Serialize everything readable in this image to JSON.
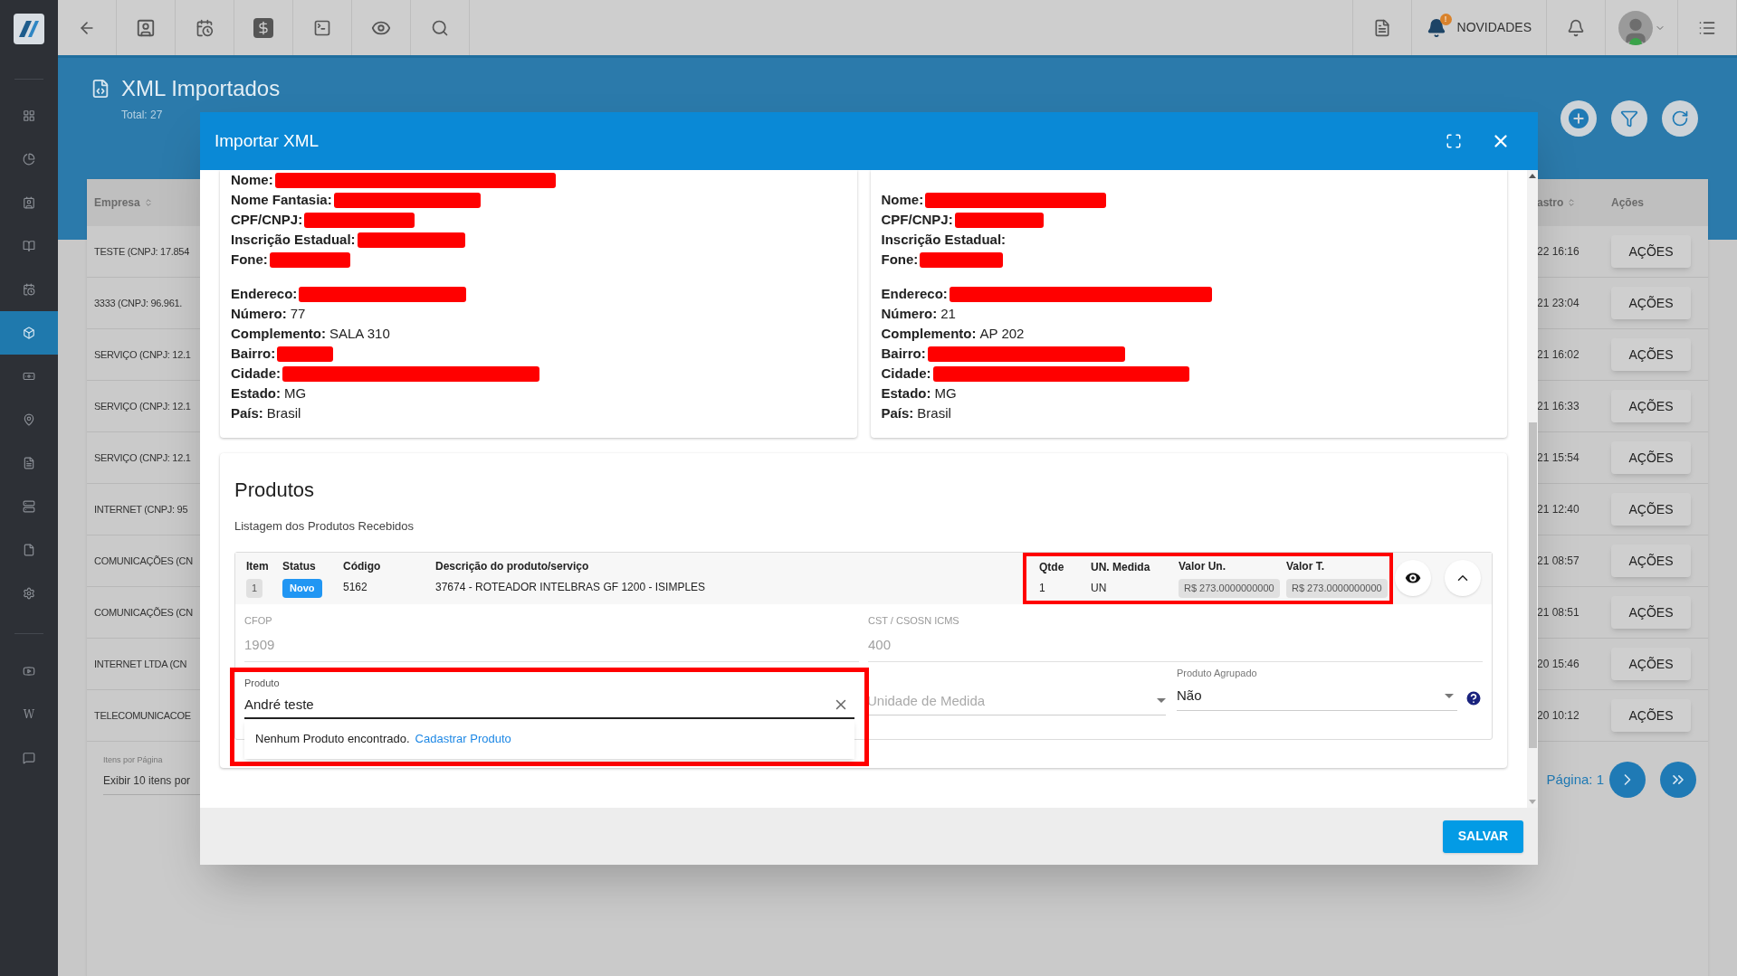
{
  "sidebar": {
    "items": [
      {
        "selected": false
      },
      {
        "selected": false
      },
      {
        "selected": false
      },
      {
        "selected": false
      },
      {
        "selected": false
      },
      {
        "selected": true
      },
      {
        "selected": false
      },
      {
        "selected": false
      },
      {
        "selected": false
      },
      {
        "selected": false
      },
      {
        "selected": false
      },
      {
        "selected": false
      },
      {
        "selected": false
      },
      {
        "selected": false,
        "glyph": "W"
      },
      {
        "selected": false
      }
    ]
  },
  "topbar": {
    "news_label": "NOVIDADES",
    "news_badge": "!"
  },
  "page": {
    "title": "XML Importados",
    "total": "Total: 27"
  },
  "table": {
    "columns": [
      "Empresa",
      "astro",
      "Ações"
    ],
    "rows": [
      {
        "empresa": "TESTE (CNPJ: 17.854",
        "cadastro": "22 16:16",
        "action": "AÇÕES"
      },
      {
        "empresa": "3333 (CNPJ: 96.961.",
        "cadastro": "21 23:04",
        "action": "AÇÕES"
      },
      {
        "empresa": "SERVIÇO (CNPJ: 12.1",
        "cadastro": "21 16:02",
        "action": "AÇÕES"
      },
      {
        "empresa": "SERVIÇO (CNPJ: 12.1",
        "cadastro": "21 16:33",
        "action": "AÇÕES"
      },
      {
        "empresa": "SERVIÇO (CNPJ: 12.1",
        "cadastro": "21 15:54",
        "action": "AÇÕES"
      },
      {
        "empresa": "INTERNET (CNPJ: 95",
        "cadastro": "21 12:40",
        "action": "AÇÕES"
      },
      {
        "empresa": "COMUNICAÇÕES (CN",
        "cadastro": "21 08:57",
        "action": "AÇÕES"
      },
      {
        "empresa": "COMUNICAÇÕES (CN",
        "cadastro": "21 08:51",
        "action": "AÇÕES"
      },
      {
        "empresa": "INTERNET LTDA (CN",
        "cadastro": "20 15:46",
        "action": "AÇÕES"
      },
      {
        "empresa": "TELECOMUNICACOE",
        "cadastro": "20 10:12",
        "action": "AÇÕES"
      }
    ]
  },
  "pagination": {
    "per_page_label": "Itens por Página",
    "per_page_value": "Exibir 10 itens por",
    "page": "Página: 1"
  },
  "modal": {
    "title": "Importar XML",
    "parties": [
      {
        "groups": [
          [
            {
              "label": "Nome:",
              "redacted": true
            },
            {
              "label": "Nome Fantasia:",
              "redacted": true
            },
            {
              "label": "CPF/CNPJ:",
              "redacted": true
            },
            {
              "label": "Inscrição Estadual:",
              "redacted": true
            },
            {
              "label": "Fone:",
              "redacted": true
            }
          ],
          [
            {
              "label": "Endereco:",
              "redacted": true
            },
            {
              "label": "Número:",
              "value": "77"
            },
            {
              "label": "Complemento:",
              "value": "SALA 310"
            },
            {
              "label": "Bairro:",
              "redacted": true
            },
            {
              "label": "Cidade:",
              "redacted": true
            },
            {
              "label": "Estado:",
              "value": "MG"
            },
            {
              "label": "País:",
              "value": "Brasil"
            }
          ]
        ]
      },
      {
        "groups": [
          [
            {
              "label": "Nome:",
              "redacted": true
            },
            {
              "label": "CPF/CNPJ:",
              "redacted": true
            },
            {
              "label": "Inscrição Estadual:"
            },
            {
              "label": "Fone:",
              "redacted": true
            }
          ],
          [
            {
              "label": "Endereco:",
              "redacted": true
            },
            {
              "label": "Número:",
              "value": "21"
            },
            {
              "label": "Complemento:",
              "value": "AP 202"
            },
            {
              "label": "Bairro:",
              "redacted": true
            },
            {
              "label": "Cidade:",
              "redacted": true
            },
            {
              "label": "Estado:",
              "value": "MG"
            },
            {
              "label": "País:",
              "value": "Brasil"
            }
          ]
        ]
      }
    ],
    "products": {
      "title": "Produtos",
      "subtitle": "Listagem dos Produtos Recebidos",
      "item": {
        "expanded": true,
        "columns": [
          {
            "label": "Item",
            "value": "1",
            "kind": "chip"
          },
          {
            "label": "Status",
            "value": "Novo",
            "kind": "badge"
          },
          {
            "label": "Código",
            "value": "5162",
            "kind": "text"
          },
          {
            "label": "Descrição do produto/serviço",
            "value": "37674 - ROTEADOR INTELBRAS GF 1200 - ISIMPLES",
            "kind": "text"
          }
        ],
        "unit_block": {
          "highlighted": true,
          "columns": [
            {
              "label": "Qtde",
              "value": "1",
              "kind": "text"
            },
            {
              "label": "UN. Medida",
              "value": "UN",
              "kind": "text"
            },
            {
              "label": "Valor Un.",
              "value": "R$ 273.0000000000",
              "kind": "chip"
            },
            {
              "label": "Valor T.",
              "value": "R$ 273.0000000000",
              "kind": "chip"
            }
          ]
        },
        "fields": [
          {
            "label": "CFOP",
            "value": "1909",
            "disabled": true
          },
          {
            "label": "CST / CSOSN ICMS",
            "value": "400",
            "disabled": true
          }
        ],
        "product_field": {
          "label": "Produto",
          "value": "André teste",
          "highlighted": true
        },
        "unit_field": {
          "placeholder": "Unidade de Medida"
        },
        "grouped_field": {
          "label": "Produto Agrupado",
          "value": "Não"
        },
        "suggestion": {
          "message": "Nenhum Produto encontrado.",
          "link": "Cadastrar Produto"
        }
      }
    },
    "save": "SALVAR"
  }
}
